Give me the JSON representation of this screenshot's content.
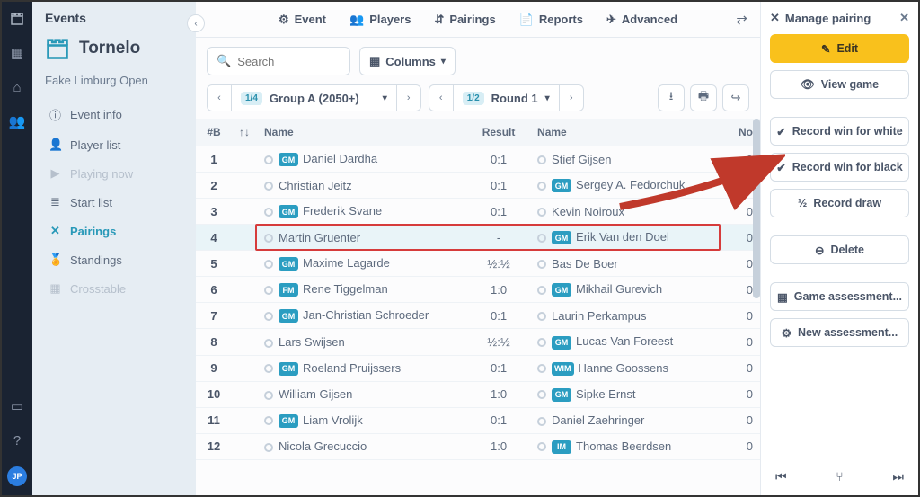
{
  "sidebar": {
    "heading": "Events",
    "brand": "Tornelo",
    "subtitle": "Fake Limburg Open",
    "nav": [
      {
        "icon": "ⓘ",
        "label": "Event info"
      },
      {
        "icon": "👤",
        "label": "Player list"
      },
      {
        "icon": "▶",
        "label": "Playing now",
        "muted": true
      },
      {
        "icon": "≣",
        "label": "Start list"
      },
      {
        "icon": "✕",
        "label": "Pairings",
        "active": true
      },
      {
        "icon": "🏅",
        "label": "Standings"
      },
      {
        "icon": "▦",
        "label": "Crosstable",
        "muted": true
      }
    ]
  },
  "topbar": {
    "items": [
      {
        "icon": "⚙",
        "label": "Event"
      },
      {
        "icon": "👥",
        "label": "Players"
      },
      {
        "icon": "⇵",
        "label": "Pairings"
      },
      {
        "icon": "📄",
        "label": "Reports"
      },
      {
        "icon": "✈",
        "label": "Advanced"
      }
    ]
  },
  "toolbar": {
    "search_placeholder": "Search",
    "columns_label": "Columns"
  },
  "group": {
    "badge": "1/4",
    "label": "Group A (2050+)",
    "round_badge": "1/2",
    "round_label": "Round 1"
  },
  "table": {
    "headers": {
      "b": "#B",
      "sort": "↑↓",
      "name": "Name",
      "result": "Result",
      "name2": "Name",
      "no": "No"
    },
    "rows": [
      {
        "n": 1,
        "wt": "GM",
        "w": "Daniel Dardha",
        "r": "0:1",
        "bt": "",
        "b": "Stief Gijsen",
        "no": 0
      },
      {
        "n": 2,
        "wt": "",
        "w": "Christian Jeitz",
        "r": "0:1",
        "bt": "GM",
        "b": "Sergey A. Fedorchuk",
        "no": 0
      },
      {
        "n": 3,
        "wt": "GM",
        "w": "Frederik Svane",
        "r": "0:1",
        "bt": "",
        "b": "Kevin Noiroux",
        "no": 0
      },
      {
        "n": 4,
        "wt": "",
        "w": "Martin Gruenter",
        "r": "-",
        "bt": "GM",
        "b": "Erik Van den Doel",
        "no": 0,
        "sel": true
      },
      {
        "n": 5,
        "wt": "GM",
        "w": "Maxime Lagarde",
        "r": "½:½",
        "bt": "",
        "b": "Bas De Boer",
        "no": 0
      },
      {
        "n": 6,
        "wt": "FM",
        "w": "Rene Tiggelman",
        "r": "1:0",
        "bt": "GM",
        "b": "Mikhail Gurevich",
        "no": 0
      },
      {
        "n": 7,
        "wt": "GM",
        "w": "Jan-Christian Schroeder",
        "r": "0:1",
        "bt": "",
        "b": "Laurin Perkampus",
        "no": 0
      },
      {
        "n": 8,
        "wt": "",
        "w": "Lars Swijsen",
        "r": "½:½",
        "bt": "GM",
        "b": "Lucas Van Foreest",
        "no": 0
      },
      {
        "n": 9,
        "wt": "GM",
        "w": "Roeland Pruijssers",
        "r": "0:1",
        "bt": "WIM",
        "b": "Hanne Goossens",
        "no": 0
      },
      {
        "n": 10,
        "wt": "",
        "w": "William Gijsen",
        "r": "1:0",
        "bt": "GM",
        "b": "Sipke Ernst",
        "no": 0
      },
      {
        "n": 11,
        "wt": "GM",
        "w": "Liam Vrolijk",
        "r": "0:1",
        "bt": "",
        "b": "Daniel Zaehringer",
        "no": 0
      },
      {
        "n": 12,
        "wt": "",
        "w": "Nicola Grecuccio",
        "r": "1:0",
        "bt": "IM",
        "b": "Thomas Beerdsen",
        "no": 0
      }
    ]
  },
  "panel": {
    "title": "Manage pairing",
    "edit": "Edit",
    "view": "View game",
    "white": "Record win for white",
    "black": "Record win for black",
    "draw": "Record draw",
    "draw_icon": "½",
    "delete": "Delete",
    "assess": "Game assessment...",
    "newassess": "New assessment..."
  },
  "rail_avatar": "JP"
}
